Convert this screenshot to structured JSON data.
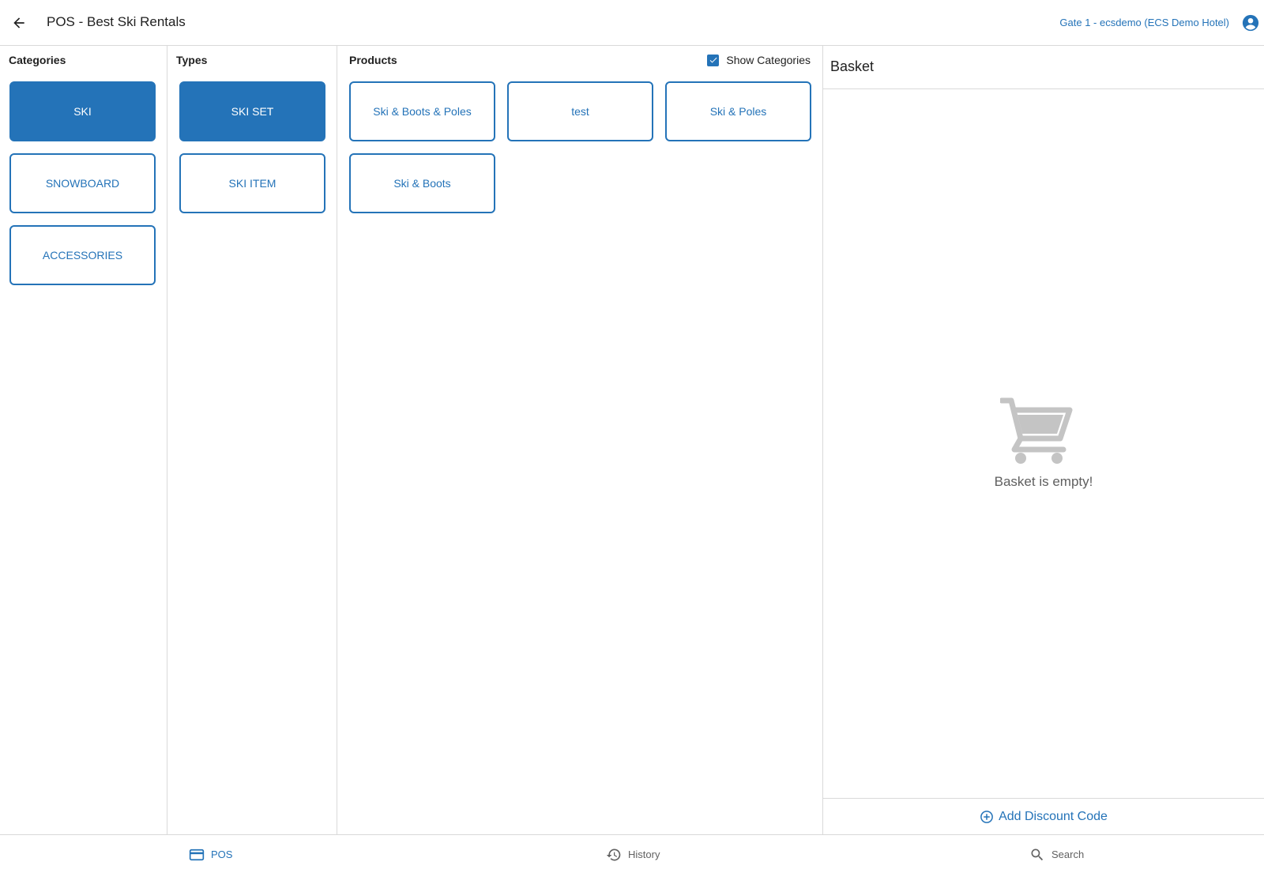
{
  "app": {
    "title": "POS - Best Ski Rentals",
    "user_info": "Gate 1 - ecsdemo (ECS Demo Hotel)",
    "accent_color": "#2473b8"
  },
  "categories": {
    "header": "Categories",
    "items": [
      {
        "label": "SKI",
        "selected": true
      },
      {
        "label": "SNOWBOARD",
        "selected": false
      },
      {
        "label": "ACCESSORIES",
        "selected": false
      }
    ]
  },
  "types": {
    "header": "Types",
    "items": [
      {
        "label": "SKI SET",
        "selected": true
      },
      {
        "label": "SKI ITEM",
        "selected": false
      }
    ]
  },
  "products": {
    "header": "Products",
    "show_categories_label": "Show Categories",
    "show_categories_checked": true,
    "items": [
      {
        "label": "Ski & Boots & Poles"
      },
      {
        "label": "test"
      },
      {
        "label": "Ski & Poles"
      },
      {
        "label": "Ski & Boots"
      }
    ]
  },
  "basket": {
    "title": "Basket",
    "empty_text": "Basket is empty!",
    "add_discount_label": "Add Discount Code"
  },
  "nav": {
    "items": [
      {
        "label": "POS",
        "icon": "credit-card-icon",
        "active": true
      },
      {
        "label": "History",
        "icon": "history-icon",
        "active": false
      },
      {
        "label": "Search",
        "icon": "search-icon",
        "active": false
      }
    ]
  }
}
